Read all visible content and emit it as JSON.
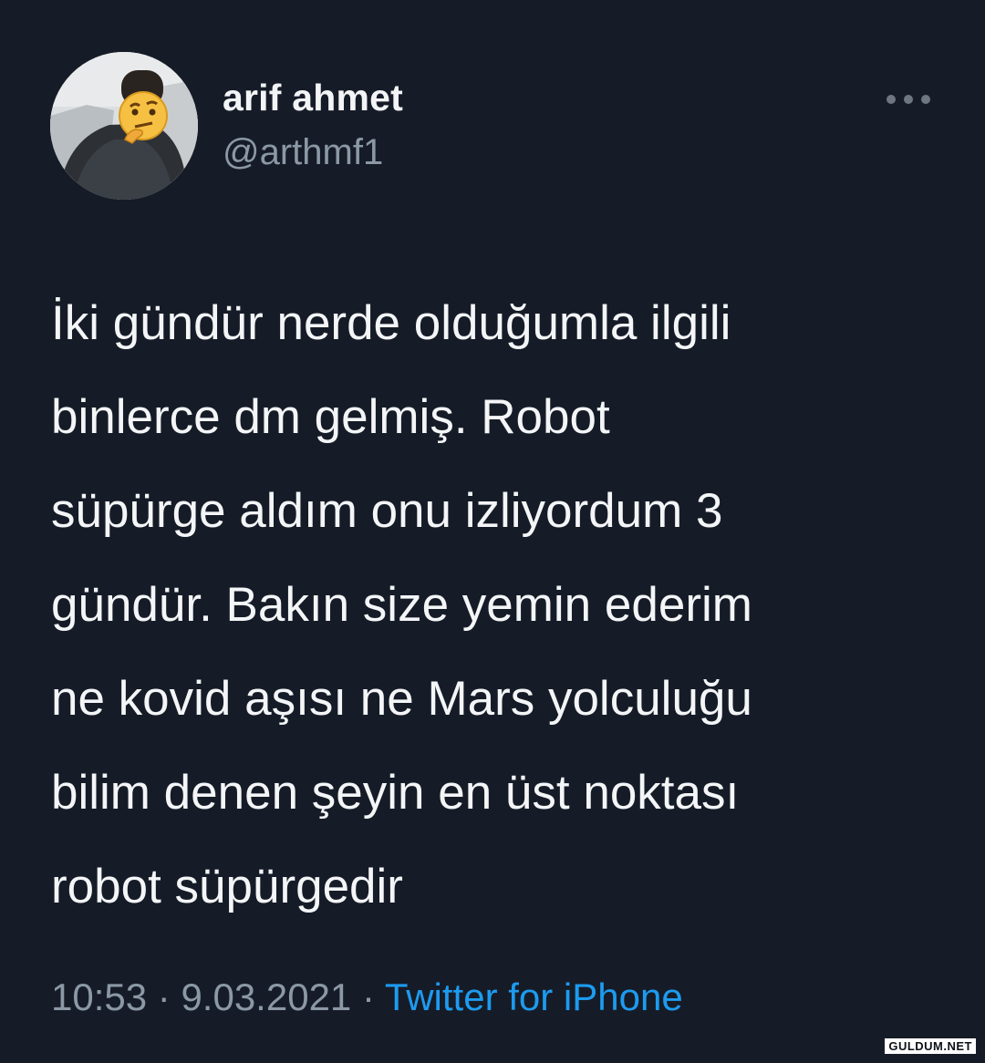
{
  "tweet": {
    "author": {
      "display_name": "arif ahmet",
      "handle": "@arthmf1",
      "avatar_icon": "profile-photo-with-thinking-face-emoji"
    },
    "more_icon": "more-horizontal-icon",
    "text_lines": [
      "İki gündür nerde olduğumla ilgili",
      "binlerce dm gelmiş. Robot",
      "süpürge aldım onu izliyordum 3",
      "gündür. Bakın size yemin ederim",
      "ne kovid aşısı ne Mars yolculuğu",
      "bilim denen şeyin en üst noktası",
      "robot süpürgedir"
    ],
    "time": "10:53",
    "separator": " · ",
    "date": "9.03.2021",
    "source": "Twitter for iPhone"
  },
  "watermark": "GULDUM.NET",
  "colors": {
    "background": "#161c27",
    "text": "#f3f5f7",
    "secondary_text": "#8b98a5",
    "link": "#1d9bf0"
  }
}
